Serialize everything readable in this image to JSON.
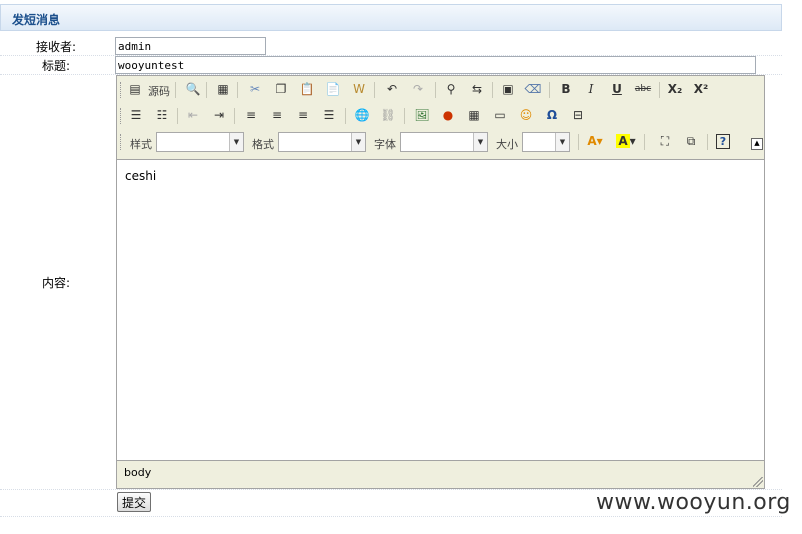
{
  "page": {
    "header_title": "发短消息"
  },
  "form": {
    "receiver_label": "接收者:",
    "receiver_value": "admin",
    "title_label": "标题:",
    "title_value": "wooyuntest",
    "content_label": "内容:",
    "submit_label": "提交"
  },
  "editor": {
    "toolbar1": {
      "source_label": "源码"
    },
    "toolbar3": {
      "style_label": "样式",
      "format_label": "格式",
      "font_label": "字体",
      "size_label": "大小"
    },
    "content_text": "ceshi",
    "path_text": "body"
  },
  "watermark": "www.wooyun.org"
}
